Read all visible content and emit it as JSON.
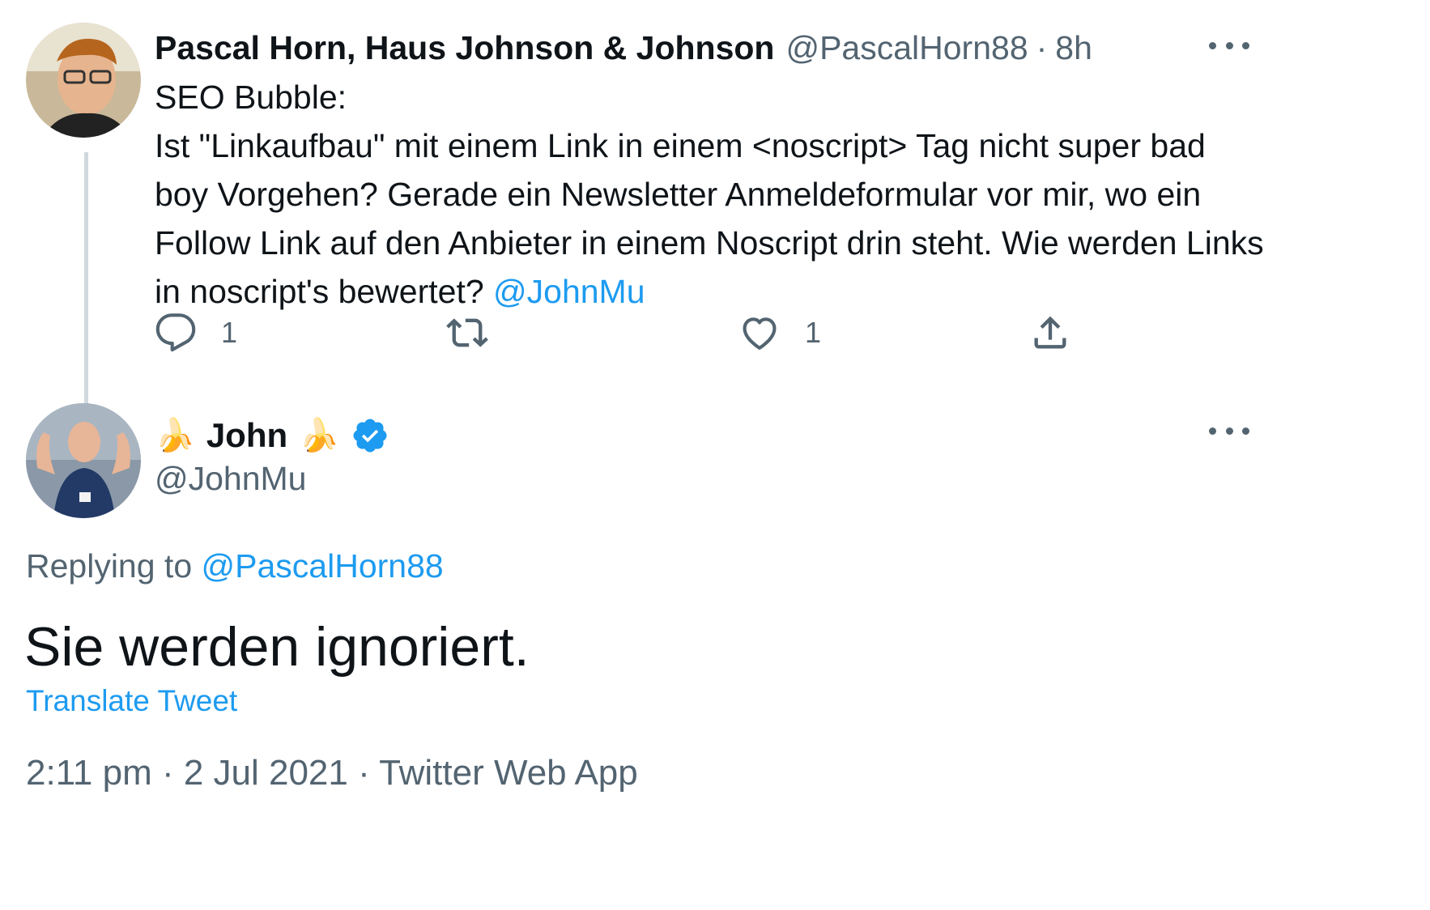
{
  "tweet": {
    "author_name": "Pascal Horn, Haus Johnson & Johnson",
    "handle": "@PascalHorn88",
    "separator": "·",
    "time": "8h",
    "lines": [
      "SEO Bubble:",
      "Ist \"Linkaufbau\" mit einem Link in einem <noscript> Tag nicht super bad",
      "boy Vorgehen? Gerade ein Newsletter Anmeldeformular vor mir, wo ein",
      "Follow Link auf den Anbieter in einem Noscript drin steht. Wie werden Links"
    ],
    "last_line_prefix": "in noscript's bewertet? ",
    "mention": "@JohnMu",
    "reply_count": "1",
    "like_count": "1",
    "icons": [
      "reply-icon",
      "retweet-icon",
      "like-icon",
      "share-icon",
      "more-icon"
    ]
  },
  "reply": {
    "emoji": "🍌",
    "display_name": "John",
    "handle": "@JohnMu",
    "verified": true,
    "replying_prefix": "Replying to",
    "replying_handle": "@PascalHorn88",
    "text": "Sie werden ignoriert.",
    "translate_label": "Translate Tweet",
    "timestamp": "2:11 pm · 2 Jul 2021 · Twitter Web App"
  },
  "colors": {
    "accent": "#1d9bf0",
    "text": "#0f1419",
    "muted": "#536471",
    "thread_line": "#cfd9de"
  }
}
